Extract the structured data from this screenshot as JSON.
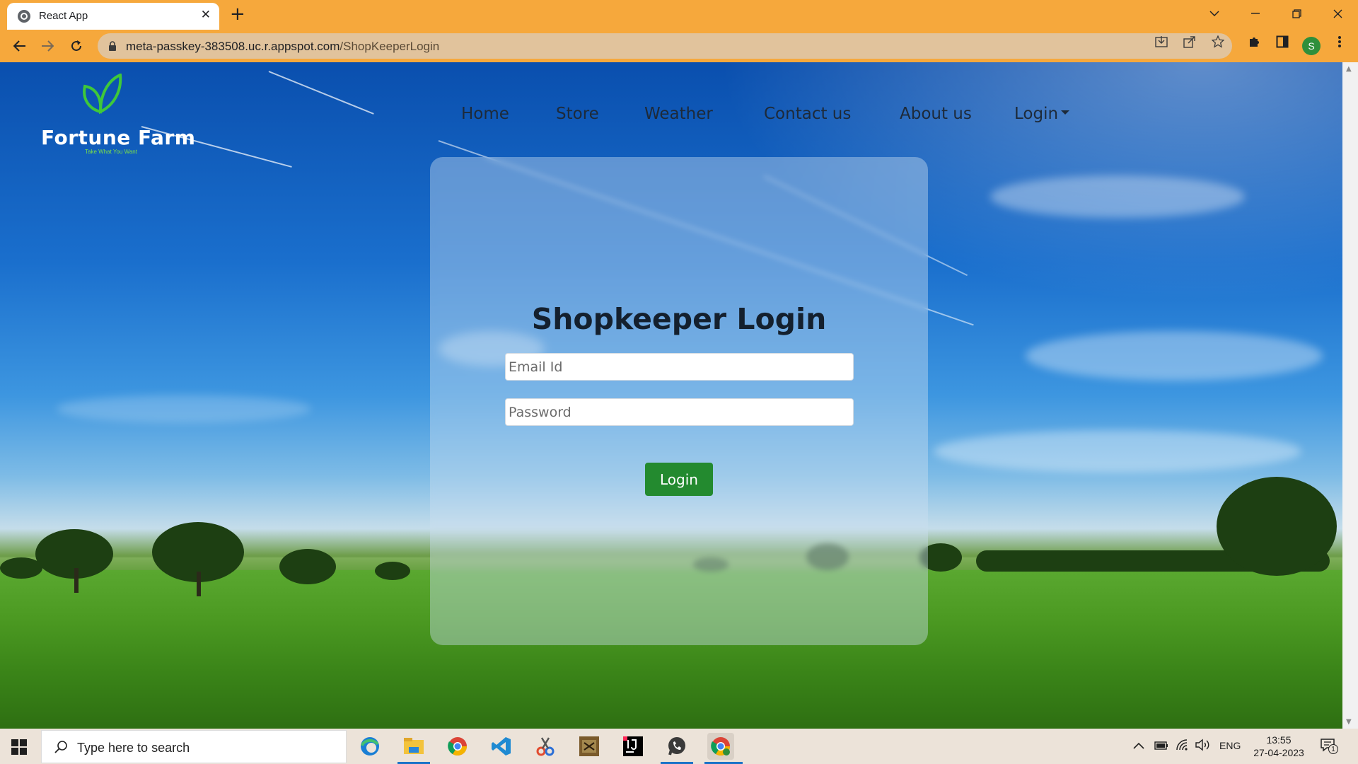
{
  "browser": {
    "tab_title": "React App",
    "tab_close": "✕",
    "new_tab": "+",
    "url_host": "meta-passkey-383508.uc.r.appspot.com",
    "url_path": "/ShopKeeperLogin",
    "profile_initial": "S"
  },
  "site": {
    "brand_name": "Fortune Farm",
    "brand_tagline": "Take What You Want",
    "nav": [
      "Home",
      "Store",
      "Weather",
      "Contact us",
      "About us",
      "Login"
    ],
    "accent_color": "#238a2f"
  },
  "login": {
    "title": "Shopkeeper Login",
    "email_placeholder": "Email Id",
    "password_placeholder": "Password",
    "button_label": "Login"
  },
  "taskbar": {
    "search_placeholder": "Type here to search",
    "language": "ENG",
    "time": "13:55",
    "date": "27-04-2023",
    "notification_count": "1"
  }
}
